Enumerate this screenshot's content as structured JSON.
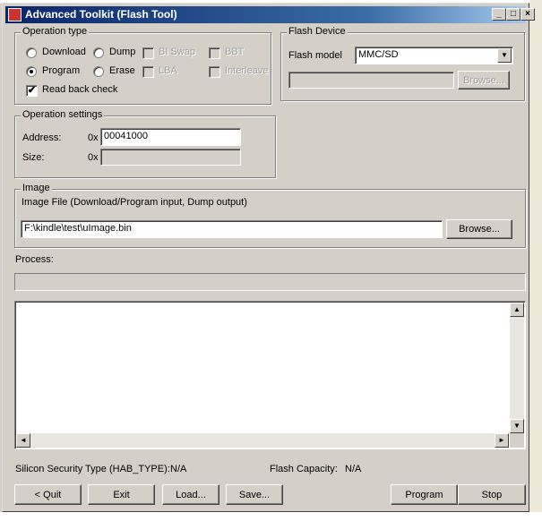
{
  "window": {
    "title": "Advanced Toolkit (Flash Tool)",
    "minimize": "_",
    "maximize": "□",
    "close": "×"
  },
  "operation_type": {
    "title": "Operation type",
    "download": "Download",
    "dump": "Dump",
    "bi_swap": "BI Swap",
    "bbt": "BBT",
    "program": "Program",
    "erase": "Erase",
    "lba": "LBA",
    "interleave": "Interleave",
    "read_back_check": "Read back check",
    "selected": "Program",
    "read_back_checked": true
  },
  "flash_device": {
    "title": "Flash Device",
    "model_label": "Flash model",
    "model_value": "MMC/SD",
    "browse": "Browse..."
  },
  "operation_settings": {
    "title": "Operation settings",
    "address_label": "Address:",
    "address_prefix": "0x",
    "address_value": "00041000",
    "size_label": "Size:",
    "size_prefix": "0x",
    "size_value": ""
  },
  "image": {
    "title": "Image",
    "description": "Image File (Download/Program input, Dump output)",
    "path": "F:\\kindle\\test\\uImage.bin",
    "browse": "Browse..."
  },
  "process": {
    "label": "Process:",
    "progress": 0
  },
  "status": {
    "security_label": "Silicon Security Type (HAB_TYPE):",
    "security_value": "N/A",
    "capacity_label": "Flash Capacity:",
    "capacity_value": "N/A"
  },
  "buttons": {
    "quit": "< Quit",
    "exit": "Exit",
    "load": "Load...",
    "save": "Save...",
    "program": "Program",
    "stop": "Stop"
  },
  "icons": {
    "scroll_up": "▲",
    "scroll_down": "▼",
    "scroll_left": "◄",
    "scroll_right": "►",
    "combo_arrow": "▼",
    "checkmark": "✔"
  }
}
